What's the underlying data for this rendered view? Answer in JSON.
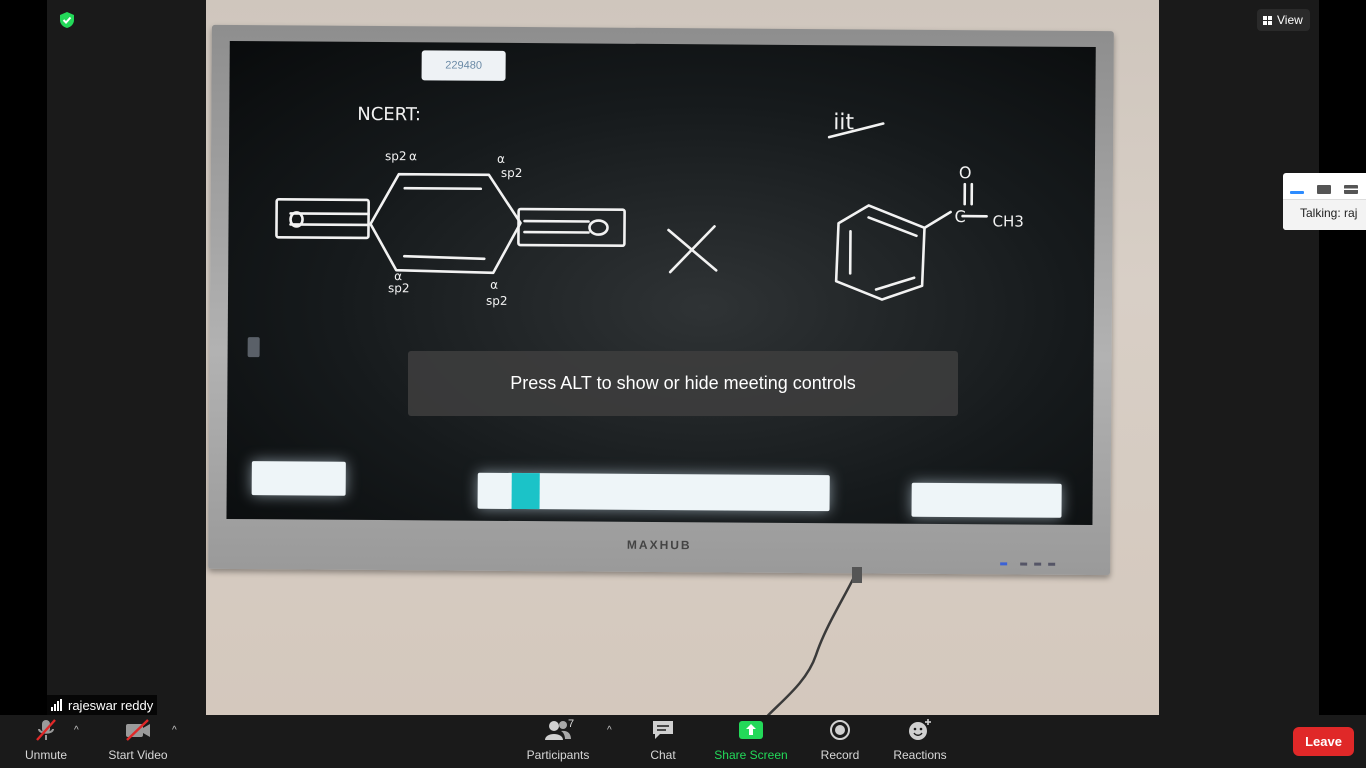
{
  "video": {
    "board_code": "229480",
    "monitor_brand": "MAXHUB",
    "board_notes": {
      "left_heading": "NCERT:",
      "right_heading": "iit",
      "hybrid_labels": [
        "sp2",
        "α",
        "sp2",
        "α",
        "sp2",
        "α",
        "sp2",
        "α"
      ],
      "ketone_group": [
        "O",
        "C",
        "CH3"
      ],
      "cross_mark": "×"
    }
  },
  "top_right": {
    "view_label": "View"
  },
  "talking": {
    "label": "Talking: raj"
  },
  "toast": {
    "message": "Press ALT to show or hide meeting controls"
  },
  "participant": {
    "name": "rajeswar reddy"
  },
  "toolbar": {
    "unmute_label": "Unmute",
    "start_video_label": "Start Video",
    "participants_label": "Participants",
    "participants_count": "7",
    "chat_label": "Chat",
    "share_screen_label": "Share Screen",
    "record_label": "Record",
    "reactions_label": "Reactions",
    "leave_label": "Leave"
  },
  "colors": {
    "share_green": "#23d959",
    "leave_red": "#e02828",
    "accent_blue": "#2d8cff",
    "toolbar_bg": "#1a1a1a"
  }
}
